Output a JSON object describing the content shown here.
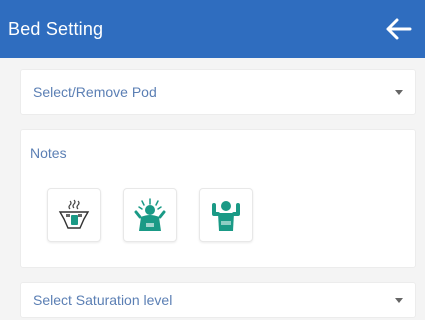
{
  "appbar": {
    "title": "Bed Setting",
    "back_icon": "arrow-left-icon",
    "color": "#2f6dbf"
  },
  "pod_select": {
    "value": "Select/Remove Pod",
    "icon": "caret-down-icon"
  },
  "notes": {
    "title": "Notes",
    "items": [
      {
        "icon": "bed-pan-icon"
      },
      {
        "icon": "patient-hot-icon"
      },
      {
        "icon": "patient-strong-icon"
      }
    ],
    "icon_color": "#1a9a86"
  },
  "saturation_select": {
    "value": "Select Saturation level",
    "icon": "caret-down-icon"
  }
}
